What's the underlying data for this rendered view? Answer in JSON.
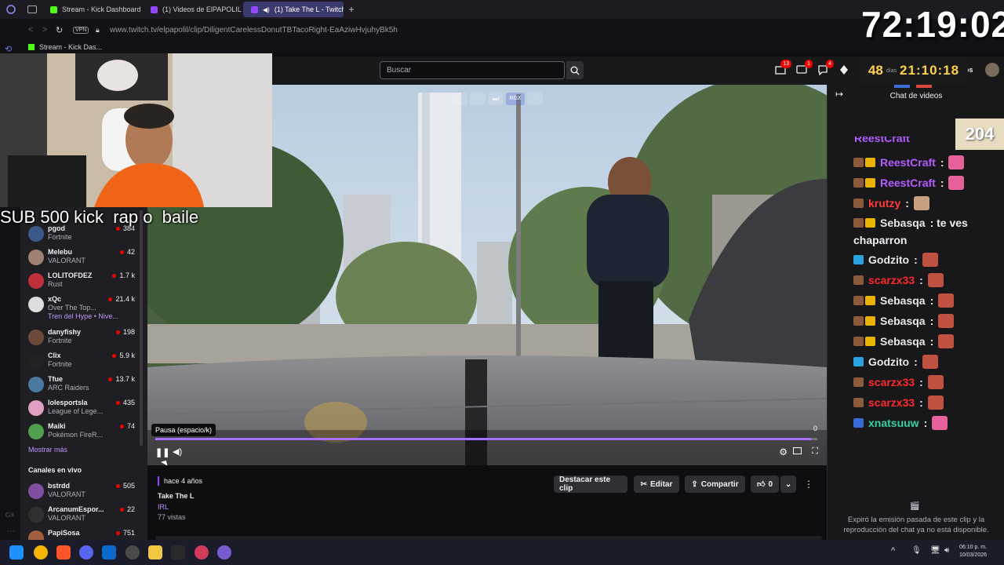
{
  "browser": {
    "tabs": [
      {
        "label": "Stream - Kick Dashboard",
        "color": "#53fc18"
      },
      {
        "label": "(1) Videos de ElPAPOLIL -",
        "color": "#9147ff"
      },
      {
        "label": "(1) Take The L - Twitch",
        "color": "#9147ff"
      }
    ],
    "vpn": "VPN",
    "url": "www.twitch.tv/elpapolil/clip/DiligentCarelessDonutTBTacoRight-EaAziwHvjuhyBk5h",
    "bookmark": "Stream - Kick Das..."
  },
  "header": {
    "search_placeholder": "Buscar",
    "badges": [
      "13",
      "1",
      "4"
    ],
    "trailing": "os"
  },
  "stream_overlay": {
    "timer": "72:19:02",
    "countdown_days": "48",
    "countdown_days_label": "días",
    "countdown_time": "21:10:18",
    "sub_goal": "SUB 500 kick  rap o  baile",
    "counter": "204"
  },
  "sidebar": {
    "channels": [
      {
        "name": "pgod",
        "game": "Fortnite",
        "viewers": "384",
        "color": "#3b5a8a"
      },
      {
        "name": "Melebu",
        "game": "VALORANT",
        "viewers": "42",
        "color": "#a08070"
      },
      {
        "name": "LOLITOFDEZ",
        "game": "Rust",
        "viewers": "1.7 k",
        "color": "#c0303a"
      },
      {
        "name": "xQc",
        "game": "Over The Top...",
        "viewers": "21.4 k",
        "color": "#dddddd",
        "sub": "Tren del Hype • Nive..."
      },
      {
        "name": "danyfishy",
        "game": "Fortnite",
        "viewers": "198",
        "color": "#6b4a3a"
      },
      {
        "name": "Clix",
        "game": "Fortnite",
        "viewers": "5.9 k",
        "color": "#222222"
      },
      {
        "name": "Tfue",
        "game": "ARC Raiders",
        "viewers": "13.7 k",
        "color": "#4a7aa0"
      },
      {
        "name": "lolesportsla",
        "game": "League of Lege...",
        "viewers": "435",
        "color": "#e0a0c0"
      },
      {
        "name": "Maiki",
        "game": "Pokémon FireR...",
        "viewers": "74",
        "color": "#50a050"
      }
    ],
    "show_more": "Mostrar más",
    "live_heading": "Canales en vivo",
    "live_channels": [
      {
        "name": "bstrdd",
        "game": "VALORANT",
        "viewers": "505",
        "color": "#8050a0"
      },
      {
        "name": "ArcanumEspor...",
        "game": "VALORANT",
        "viewers": "22",
        "color": "#303030"
      },
      {
        "name": "PapiSosa",
        "game": "",
        "viewers": "751",
        "color": "#a06040"
      }
    ]
  },
  "player": {
    "tooltip": "Pausa (espacio/k)",
    "progress": 0.99,
    "end_time": "0",
    "quality": "RGX"
  },
  "clip": {
    "age": "hace 4 años",
    "title": "Take The L",
    "category": "IRL",
    "views": "77 vistas",
    "feature_btn": "Destacar este clip",
    "edit_btn": "Editar",
    "share_btn": "Compartir",
    "likes": "0"
  },
  "chat": {
    "title": "Chat de videos",
    "partial_name": "ReestCraft",
    "messages": [
      {
        "name": "ReestCraft",
        "color": "#b45cff",
        "text": ":",
        "emote": "#e6609a"
      },
      {
        "name": "ReestCraft",
        "color": "#b45cff",
        "text": ":",
        "emote": "#e6609a"
      },
      {
        "name": "krutzy",
        "color": "#ff3b3b",
        "text": ":",
        "emote": "#c8a080"
      },
      {
        "name": "Sebasqa",
        "color": "#e8e8e8",
        "text": ": te ves",
        "emote": ""
      },
      {
        "name": "Godzito",
        "color": "#e8e8e8",
        "text": ":",
        "emote": "#c05040"
      },
      {
        "name": "scarzx33",
        "color": "#ff2a2a",
        "text": ":",
        "emote": "#c05040"
      },
      {
        "name": "Sebasqa",
        "color": "#e8e8e8",
        "text": ":",
        "emote": "#c05040"
      },
      {
        "name": "Sebasqa",
        "color": "#e8e8e8",
        "text": ":",
        "emote": "#c05040"
      },
      {
        "name": "Sebasqa",
        "color": "#e8e8e8",
        "text": ":",
        "emote": "#c05040"
      },
      {
        "name": "Godzito",
        "color": "#e8e8e8",
        "text": ":",
        "emote": "#c05040"
      },
      {
        "name": "scarzx33",
        "color": "#ff2a2a",
        "text": ":",
        "emote": "#c05040"
      },
      {
        "name": "scarzx33",
        "color": "#ff2a2a",
        "text": ":",
        "emote": "#c05040"
      },
      {
        "name": "xnatsuuw",
        "color": "#34d1a5",
        "text": ":",
        "emote": "#e6609a"
      }
    ],
    "continuation": "chaparron",
    "expired_notice": "Expiró la emisión pasada de este clip y la reproducción del chat ya no está disponible."
  },
  "taskbar": {
    "time": "06:10 p. m.",
    "date": "10/03/2026"
  }
}
